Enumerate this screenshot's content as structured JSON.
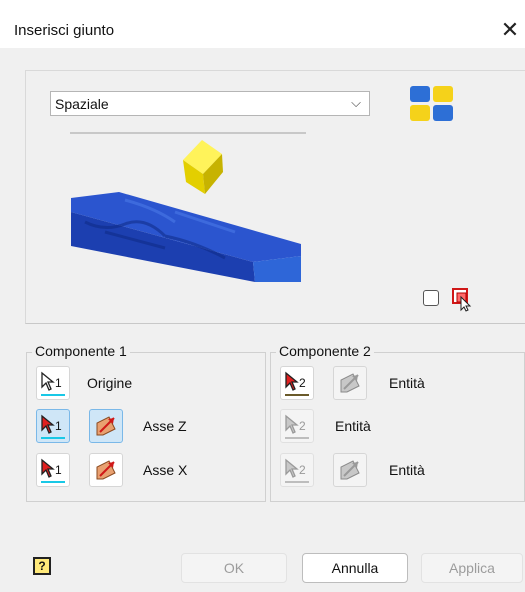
{
  "window": {
    "title": "Inserisci giunto",
    "close_glyph": "✕"
  },
  "joint_type": {
    "selected": "Spaziale",
    "chevron": "⌵"
  },
  "component1": {
    "label": "Componente 1",
    "rows": [
      {
        "pick_count": "1",
        "label": "Origine"
      },
      {
        "pick_count": "1",
        "label": "Asse Z"
      },
      {
        "pick_count": "1",
        "label": "Asse X"
      }
    ]
  },
  "component2": {
    "label": "Componente 2",
    "rows": [
      {
        "pick_count": "2",
        "label": "Entità"
      },
      {
        "pick_count": "2",
        "label": "Entità"
      },
      {
        "pick_count": "2",
        "label": "Entità"
      }
    ]
  },
  "buttons": {
    "ok": "OK",
    "cancel": "Annulla",
    "apply": "Applica",
    "help": "?"
  },
  "colors": {
    "accent_cyan": "#19c8e6",
    "active_bg": "#cfe6f7",
    "block_blue": "#1c3fb0",
    "cube_yellow": "#f2e200"
  }
}
